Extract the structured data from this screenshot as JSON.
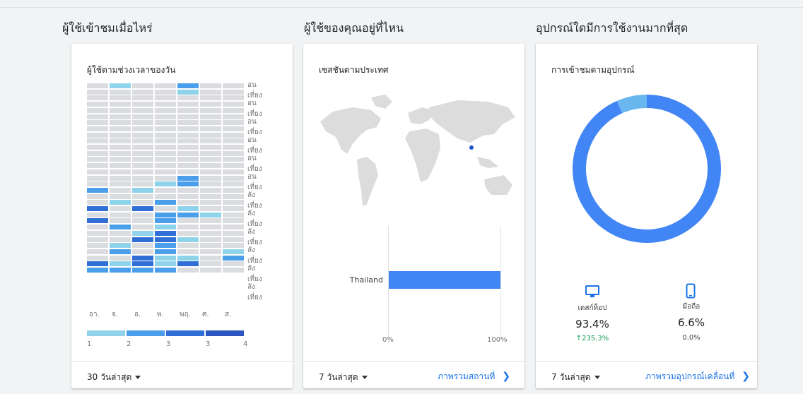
{
  "sections": {
    "when": "ผู้ใช้เข้าชมเมื่อไหร่",
    "where": "ผู้ใช้ของคุณอยู่ที่ไหน",
    "device": "อุปกรณ์ใดมีการใช้งานมากที่สุด"
  },
  "time_card": {
    "title": "ผู้ใช้ตามช่วงเวลาของวัน",
    "row_labels": [
      "อนเที่ยง",
      "อนเที่ยง",
      "อนเที่ยง",
      "อนเที่ยง",
      "อนเที่ยง",
      "อนเที่ยง",
      "ลังเที่ยง",
      "ลังเที่ยง",
      "ลังเที่ยง",
      "ลังเที่ยง",
      "ลังเที่ยง",
      "ลังเที่ยง"
    ],
    "days": [
      "อา.",
      "จ.",
      "อ.",
      "พ.",
      "พฤ.",
      "ศ.",
      "ส."
    ],
    "legend": [
      "1",
      "2",
      "3",
      "3",
      "4"
    ],
    "legend_colors": [
      "#8fd3eb",
      "#4a9eea",
      "#2f6fd6",
      "#2b55c0"
    ],
    "heat_colors": [
      "#dadce0",
      "#8fd3eb",
      "#4a9eea",
      "#2f6fd6",
      "#2b55c0"
    ],
    "heatmap": [
      [
        0,
        1,
        0,
        0,
        2,
        0,
        0
      ],
      [
        0,
        0,
        0,
        0,
        1,
        0,
        0
      ],
      [
        0,
        0,
        0,
        0,
        0,
        0,
        0
      ],
      [
        0,
        0,
        0,
        0,
        0,
        0,
        0
      ],
      [
        0,
        0,
        0,
        0,
        0,
        0,
        0
      ],
      [
        0,
        0,
        0,
        0,
        0,
        0,
        0
      ],
      [
        0,
        0,
        0,
        0,
        0,
        0,
        0
      ],
      [
        0,
        0,
        0,
        0,
        0,
        0,
        0
      ],
      [
        0,
        0,
        0,
        0,
        0,
        0,
        0
      ],
      [
        0,
        0,
        0,
        0,
        0,
        0,
        0
      ],
      [
        0,
        0,
        0,
        0,
        0,
        0,
        0
      ],
      [
        0,
        0,
        0,
        0,
        0,
        0,
        0
      ],
      [
        0,
        0,
        0,
        0,
        0,
        0,
        0
      ],
      [
        0,
        0,
        0,
        0,
        0,
        0,
        0
      ],
      [
        0,
        0,
        0,
        0,
        0,
        0,
        0
      ],
      [
        0,
        0,
        0,
        0,
        2,
        0,
        0
      ],
      [
        0,
        0,
        0,
        1,
        2,
        0,
        0
      ],
      [
        2,
        0,
        1,
        0,
        0,
        0,
        0
      ],
      [
        0,
        0,
        0,
        0,
        0,
        0,
        0
      ],
      [
        0,
        1,
        0,
        2,
        0,
        0,
        0
      ],
      [
        3,
        0,
        3,
        0,
        1,
        0,
        0
      ],
      [
        0,
        0,
        0,
        2,
        2,
        1,
        0
      ],
      [
        3,
        0,
        0,
        2,
        0,
        0,
        0
      ],
      [
        0,
        2,
        0,
        1,
        0,
        0,
        0
      ],
      [
        0,
        0,
        1,
        3,
        0,
        0,
        0
      ],
      [
        0,
        0,
        3,
        3,
        1,
        0,
        0
      ],
      [
        0,
        1,
        0,
        2,
        0,
        0,
        0
      ],
      [
        0,
        2,
        0,
        2,
        0,
        0,
        1
      ],
      [
        0,
        0,
        3,
        1,
        1,
        0,
        2
      ],
      [
        3,
        1,
        3,
        1,
        3,
        0,
        0
      ],
      [
        2,
        2,
        2,
        2,
        0,
        0,
        0
      ]
    ],
    "footer_range": "30 วันล่าสุด"
  },
  "geo_card": {
    "title": "เซสชันตามประเทศ",
    "bar_country": "Thailand",
    "bar_pct": 100,
    "axis_min": "0%",
    "axis_max": "100%",
    "footer_range": "7 วันล่าสุด",
    "footer_link": "ภาพรวมสถานที่"
  },
  "device_card": {
    "title": "การเข้าชมตามอุปกรณ์",
    "desktop_color": "#4285f4",
    "mobile_color": "#6ab7f0",
    "desktop_label": "เดสก์ท็อป",
    "mobile_label": "มือถือ",
    "desktop_pct": 93.4,
    "mobile_pct": 6.6,
    "desktop_value": "93.4%",
    "mobile_value": "6.6%",
    "desktop_change": "↑235.3%",
    "mobile_change": "0.0%",
    "footer_range": "7 วันล่าสุด",
    "footer_link": "ภาพรวมอุปกรณ์เคลื่อนที่"
  }
}
